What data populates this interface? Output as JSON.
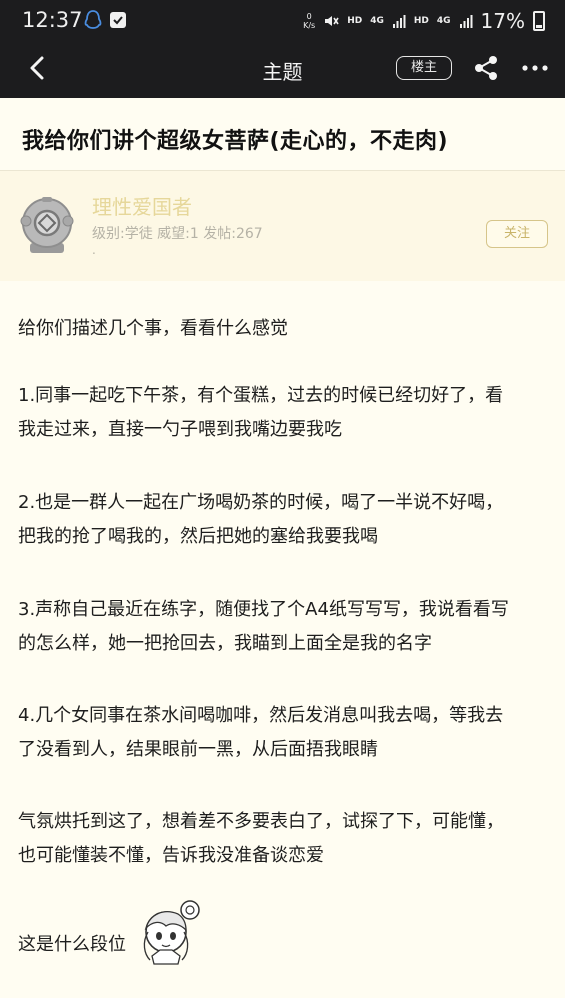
{
  "status_bar": {
    "time": "12:37",
    "net_speed": "0",
    "net_unit": "K/s",
    "hd1": "HD",
    "g1": "4G",
    "hd2": "HD",
    "g2": "4G",
    "battery_pct": "17%"
  },
  "nav": {
    "title": "主题",
    "louzhu_label": "楼主"
  },
  "post": {
    "title": "我给你们讲个超级女菩萨(走心的，不走肉)"
  },
  "author": {
    "name": "理性爱国者",
    "meta": "级别:学徒 威望:1 发帖:267",
    "dot": ".",
    "follow_label": "关注"
  },
  "body": {
    "p1": "给你们描述几个事，看看什么感觉",
    "p2a": "1.同事一起吃下午茶，有个蛋糕，过去的时候已经切好了，看",
    "p2b": "我走过来，直接一勺子喂到我嘴边要我吃",
    "p3a": "2.也是一群人一起在广场喝奶茶的时候，喝了一半说不好喝，",
    "p3b": "把我的抢了喝我的，然后把她的塞给我要我喝",
    "p4a": "3.声称自己最近在练字，随便找了个A4纸写写写，我说看看写",
    "p4b": "的怎么样，她一把抢回去，我瞄到上面全是我的名字",
    "p5a": "4.几个女同事在茶水间喝咖啡，然后发消息叫我去喝，等我去",
    "p5b": "了没看到人，结果眼前一黑，从后面捂我眼睛",
    "p6a": "气氛烘托到这了，想着差不多要表白了，试探了下，可能懂，",
    "p6b": "也可能懂装不懂，告诉我没准备谈恋爱",
    "p7": "这是什么段位"
  },
  "icons": {
    "back": "chevron-left-icon",
    "share": "share-icon",
    "more": "more-dots-icon",
    "qq": "qq-penguin-icon",
    "check": "checkbox-icon",
    "avatar": "diving-helmet-avatar",
    "mascot": "anime-girl-sticker"
  },
  "colors": {
    "bar_bg": "#1c1c1e",
    "page_bg": "#fffdf2",
    "card_bg": "#fdf8e5",
    "username": "#e6d79a",
    "follow": "#c9b469"
  }
}
